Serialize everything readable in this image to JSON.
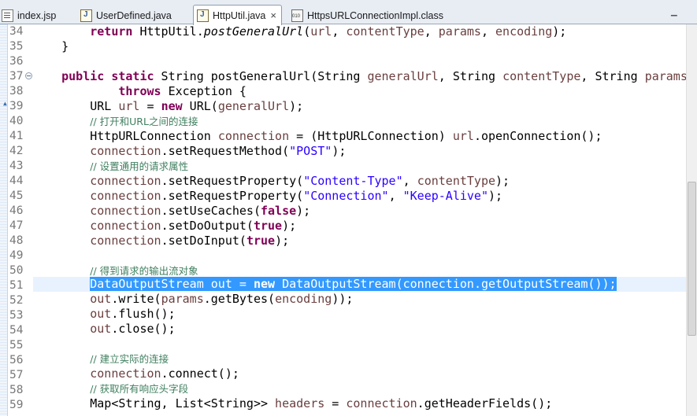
{
  "tabs": [
    {
      "label": "index.jsp",
      "icon": "jsp-file-icon",
      "active": false
    },
    {
      "label": "UserDefined.java",
      "icon": "java-file-icon",
      "active": false
    },
    {
      "label": "HttpUtil.java",
      "icon": "java-file-icon",
      "active": true,
      "close": "×"
    },
    {
      "label": "HttpsURLConnectionImpl.class",
      "icon": "class-file-icon",
      "active": false
    }
  ],
  "window_controls": {
    "minimize": "▁"
  },
  "editor": {
    "selected_line": "51",
    "lines": [
      {
        "no": "34",
        "text": "        return HttpUtil.postGeneralUrl(url, contentType, params, encoding);"
      },
      {
        "no": "35",
        "text": "    }"
      },
      {
        "no": "36",
        "text": ""
      },
      {
        "no": "37",
        "text": "    public static String postGeneralUrl(String generalUrl, String contentType, String params"
      },
      {
        "no": "38",
        "text": "            throws Exception {"
      },
      {
        "no": "39",
        "text": "        URL url = new URL(generalUrl);"
      },
      {
        "no": "40",
        "text": "        // 打开和URL之间的连接"
      },
      {
        "no": "41",
        "text": "        HttpURLConnection connection = (HttpURLConnection) url.openConnection();"
      },
      {
        "no": "42",
        "text": "        connection.setRequestMethod(\"POST\");"
      },
      {
        "no": "43",
        "text": "        // 设置通用的请求属性"
      },
      {
        "no": "44",
        "text": "        connection.setRequestProperty(\"Content-Type\", contentType);"
      },
      {
        "no": "45",
        "text": "        connection.setRequestProperty(\"Connection\", \"Keep-Alive\");"
      },
      {
        "no": "46",
        "text": "        connection.setUseCaches(false);"
      },
      {
        "no": "47",
        "text": "        connection.setDoOutput(true);"
      },
      {
        "no": "48",
        "text": "        connection.setDoInput(true);"
      },
      {
        "no": "49",
        "text": ""
      },
      {
        "no": "50",
        "text": "        // 得到请求的输出流对象"
      },
      {
        "no": "51",
        "text": "        DataOutputStream out = new DataOutputStream(connection.getOutputStream());"
      },
      {
        "no": "52",
        "text": "        out.write(params.getBytes(encoding));"
      },
      {
        "no": "53",
        "text": "        out.flush();"
      },
      {
        "no": "54",
        "text": "        out.close();"
      },
      {
        "no": "55",
        "text": ""
      },
      {
        "no": "56",
        "text": "        // 建立实际的连接"
      },
      {
        "no": "57",
        "text": "        connection.connect();"
      },
      {
        "no": "58",
        "text": "        // 获取所有响应头字段"
      },
      {
        "no": "59",
        "text": "        Map<String, List<String>> headers = connection.getHeaderFields();"
      }
    ]
  }
}
